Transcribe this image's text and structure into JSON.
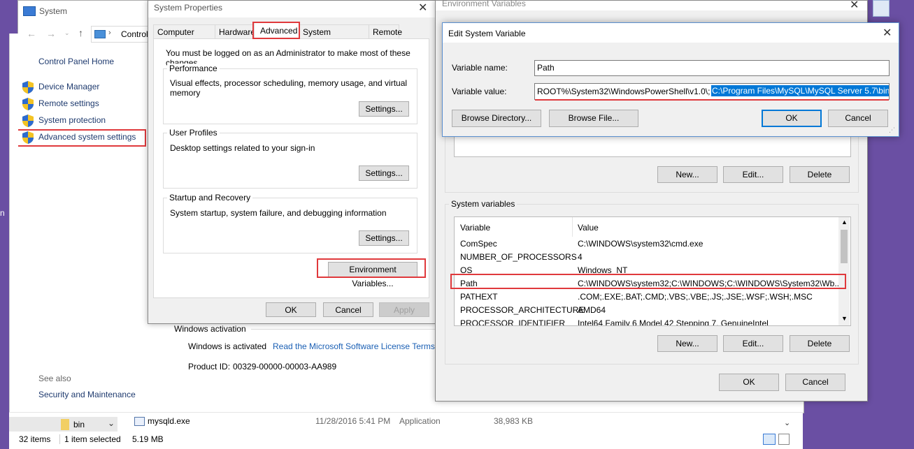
{
  "system_window": {
    "title": "System",
    "breadcrumb": "Control",
    "control_panel_home": "Control Panel Home",
    "links": [
      "Device Manager",
      "Remote settings",
      "System protection",
      "Advanced system settings"
    ],
    "see_also": "See also",
    "security_link": "Security and Maintenance",
    "activation_heading": "Windows activation",
    "activated_text": "Windows is activated",
    "license_link": "Read the Microsoft Software License Terms",
    "product_id_label": "Product ID:",
    "product_id": "00329-00000-00003-AA989"
  },
  "explorer": {
    "folder": "bin",
    "file_name": "mysqld.exe",
    "file_date": "11/28/2016 5:41 PM",
    "file_type": "Application",
    "file_size": "38,983 KB",
    "status_items": "32 items",
    "status_selected": "1 item selected",
    "status_size": "5.19 MB",
    "left_edge_text": "n"
  },
  "sysprops": {
    "title": "System Properties",
    "tabs": [
      "Computer Name",
      "Hardware",
      "Advanced",
      "System Protection",
      "Remote"
    ],
    "admin_note": "You must be logged on as an Administrator to make most of these changes.",
    "performance": {
      "legend": "Performance",
      "desc": "Visual effects, processor scheduling, memory usage, and virtual memory",
      "button": "Settings..."
    },
    "user_profiles": {
      "legend": "User Profiles",
      "desc": "Desktop settings related to your sign-in",
      "button": "Settings..."
    },
    "startup": {
      "legend": "Startup and Recovery",
      "desc": "System startup, system failure, and debugging information",
      "button": "Settings..."
    },
    "env_button": "Environment Variables...",
    "ok": "OK",
    "cancel": "Cancel",
    "apply": "Apply"
  },
  "envvars": {
    "title": "Environment Variables",
    "user_buttons": {
      "new": "New...",
      "edit": "Edit...",
      "delete": "Delete"
    },
    "system_legend": "System variables",
    "columns": [
      "Variable",
      "Value"
    ],
    "rows": [
      {
        "name": "ComSpec",
        "value": "C:\\WINDOWS\\system32\\cmd.exe"
      },
      {
        "name": "NUMBER_OF_PROCESSORS",
        "value": "4"
      },
      {
        "name": "OS",
        "value": "Windows_NT"
      },
      {
        "name": "Path",
        "value": "C:\\WINDOWS\\system32;C:\\WINDOWS;C:\\WINDOWS\\System32\\Wb..."
      },
      {
        "name": "PATHEXT",
        "value": ".COM;.EXE;.BAT;.CMD;.VBS;.VBE;.JS;.JSE;.WSF;.WSH;.MSC"
      },
      {
        "name": "PROCESSOR_ARCHITECTURE",
        "value": "AMD64"
      },
      {
        "name": "PROCESSOR_IDENTIFIER",
        "value": "Intel64 Family 6 Model 42 Stepping 7, GenuineIntel"
      }
    ],
    "sys_buttons": {
      "new": "New...",
      "edit": "Edit...",
      "delete": "Delete"
    },
    "ok": "OK",
    "cancel": "Cancel"
  },
  "edit_var": {
    "title": "Edit System Variable",
    "name_label": "Variable name:",
    "name_value": "Path",
    "value_label": "Variable value:",
    "value_prefix": "ROOT%\\System32\\WindowsPowerShell\\v1.0\\;",
    "value_selected": "C:\\Program Files\\MySQL\\MySQL Server 5.7\\bin",
    "browse_dir": "Browse Directory...",
    "browse_file": "Browse File...",
    "ok": "OK",
    "cancel": "Cancel"
  },
  "colors": {
    "highlight": "#e0393c",
    "selection": "#0078d7",
    "desktop": "#6a4fa3"
  }
}
